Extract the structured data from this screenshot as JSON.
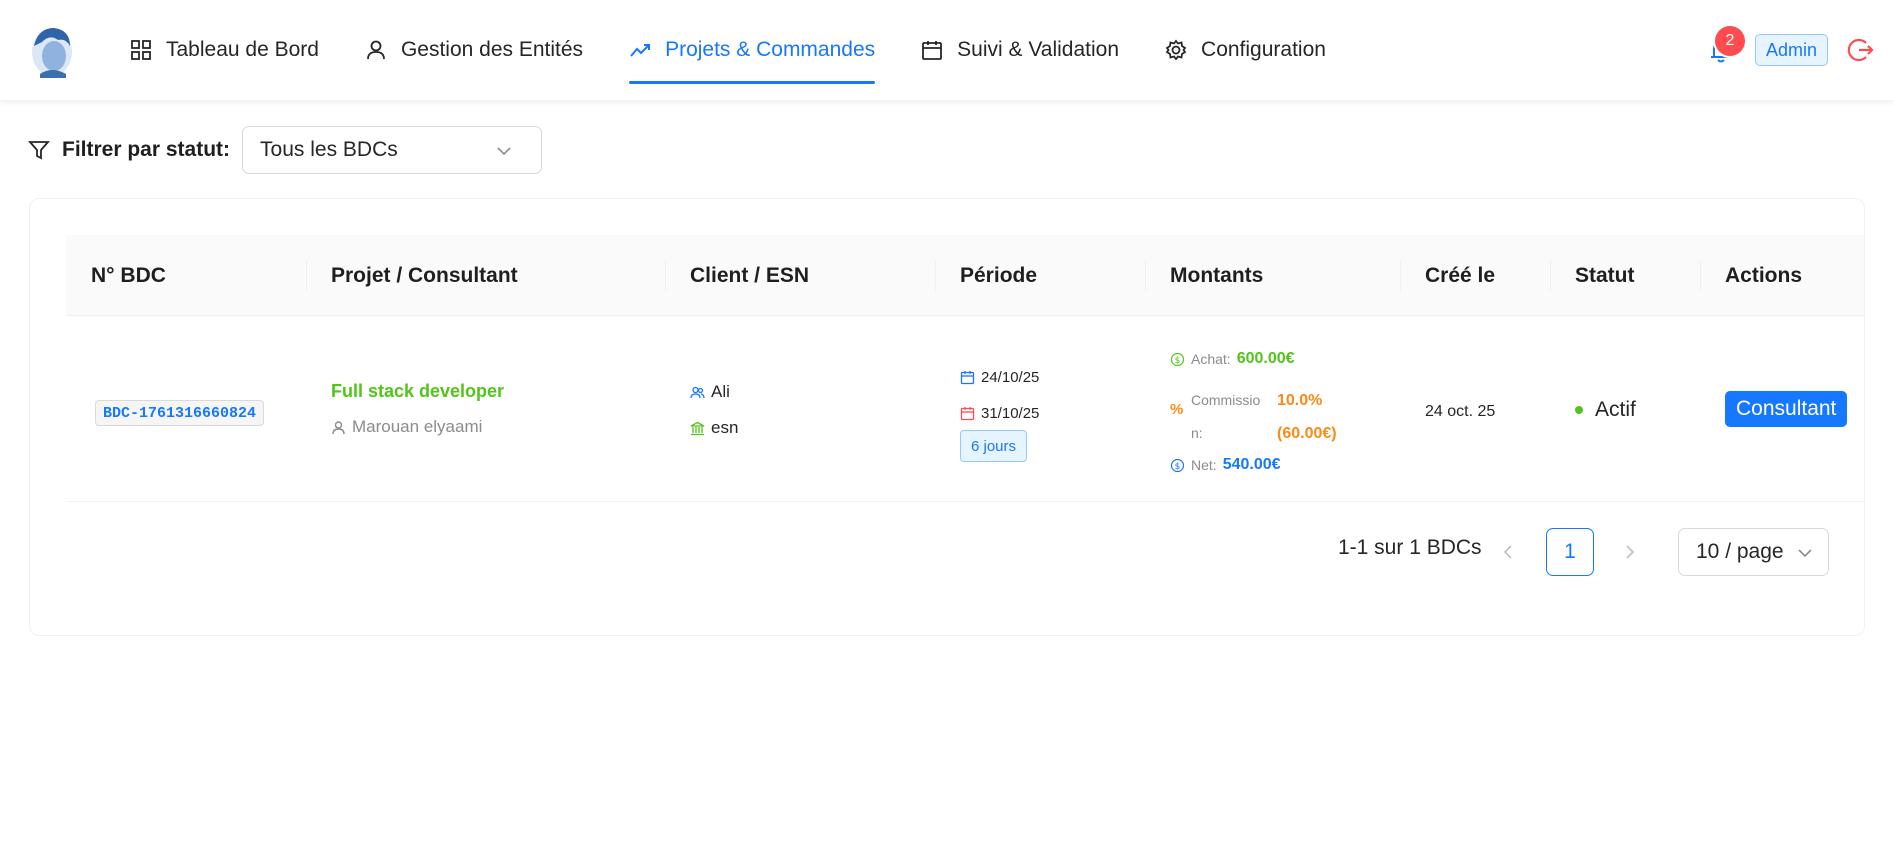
{
  "nav": {
    "items": [
      {
        "label": "Tableau de Bord",
        "icon": "dashboard-icon"
      },
      {
        "label": "Gestion des Entités",
        "icon": "user-icon"
      },
      {
        "label": "Projets & Commandes",
        "icon": "trend-icon",
        "active": true
      },
      {
        "label": "Suivi & Validation",
        "icon": "calendar-icon"
      },
      {
        "label": "Configuration",
        "icon": "gear-icon"
      }
    ],
    "notifications_count": "2",
    "user_role": "Admin"
  },
  "filter": {
    "label": "Filtrer par statut:",
    "selected": "Tous les BDCs"
  },
  "table": {
    "columns": [
      "N° BDC",
      "Projet / Consultant",
      "Client / ESN",
      "Période",
      "Montants",
      "Créé le",
      "Statut",
      "Actions"
    ],
    "rows": [
      {
        "bdc_number": "BDC-1761316660824",
        "project": "Full stack developer",
        "consultant": "Marouan elyaami",
        "client": "Ali",
        "esn": "esn",
        "start_date": "24/10/25",
        "end_date": "31/10/25",
        "duration": "6 jours",
        "achat_label": "Achat:",
        "achat_value": "600.00€",
        "commission_symbol": "%",
        "commission_label": "Commission:",
        "commission_pct": "10.0%",
        "commission_amount": "(60.00€)",
        "net_label": "Net:",
        "net_value": "540.00€",
        "created": "24 oct. 25",
        "status": "Actif",
        "action": "Consultant"
      }
    ]
  },
  "pagination": {
    "total_text": "1-1 sur 1 BDCs",
    "current_page": "1",
    "page_size": "10 / page"
  },
  "colors": {
    "primary": "#1677ff",
    "success": "#52c41a",
    "warning": "#fa8c16",
    "danger": "#ff4d4f"
  }
}
